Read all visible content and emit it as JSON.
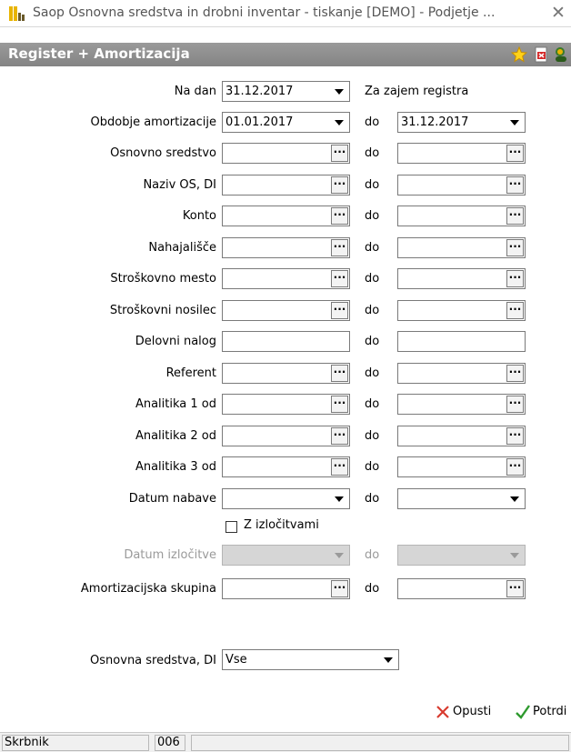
{
  "window": {
    "title": "Saop Osnovna sredstva in drobni inventar - tiskanje [DEMO] - Podjetje ...",
    "close_glyph": "✕"
  },
  "header": {
    "title": "Register + Amortizacija",
    "icons": [
      "star-icon",
      "pdf-icon",
      "user-icon"
    ]
  },
  "form": {
    "na_dan": {
      "label": "Na dan",
      "value": "31.12.2017",
      "side_label": "Za zajem registra"
    },
    "obdobje": {
      "label": "Obdobje amortizacije",
      "from": "01.01.2017",
      "to": "31.12.2017"
    },
    "do_label": "do",
    "range_rows": [
      {
        "key": "osnovno_sredstvo",
        "label": "Osnovno sredstvo",
        "type": "lookup",
        "from": "",
        "to": ""
      },
      {
        "key": "naziv_os_di",
        "label": "Naziv OS, DI",
        "type": "lookup",
        "from": "",
        "to": ""
      },
      {
        "key": "konto",
        "label": "Konto",
        "type": "lookup",
        "from": "",
        "to": ""
      },
      {
        "key": "nahajalisce",
        "label": "Nahajališče",
        "type": "lookup",
        "from": "",
        "to": ""
      },
      {
        "key": "strosek_mesto",
        "label": "Stroškovno mesto",
        "type": "lookup",
        "from": "",
        "to": ""
      },
      {
        "key": "strosek_nosilec",
        "label": "Stroškovni nosilec",
        "type": "lookup",
        "from": "",
        "to": ""
      },
      {
        "key": "delovni_nalog",
        "label": "Delovni nalog",
        "type": "text",
        "from": "",
        "to": ""
      },
      {
        "key": "referent",
        "label": "Referent",
        "type": "lookup",
        "from": "",
        "to": ""
      },
      {
        "key": "analitika1",
        "label": "Analitika 1 od",
        "type": "lookup",
        "from": "",
        "to": ""
      },
      {
        "key": "analitika2",
        "label": "Analitika 2 od",
        "type": "lookup",
        "from": "",
        "to": ""
      },
      {
        "key": "analitika3",
        "label": "Analitika 3 od",
        "type": "lookup",
        "from": "",
        "to": ""
      },
      {
        "key": "datum_nabave",
        "label": "Datum nabave",
        "type": "dropdown",
        "from": "",
        "to": ""
      }
    ],
    "z_izlocitvami": {
      "label": "Z izločitvami",
      "checked": false
    },
    "datum_izlocitve": {
      "label": "Datum izločitve",
      "from": "",
      "to": "",
      "disabled": true
    },
    "amort_skupina": {
      "label": "Amortizacijska skupina",
      "from": "",
      "to": ""
    },
    "osnovna_sredstva_di": {
      "label": "Osnovna sredstva, DI",
      "value": "Vse"
    }
  },
  "footer": {
    "cancel_label": "Opusti",
    "confirm_label": "Potrdi"
  },
  "statusbar": {
    "user": "Skrbnik",
    "code": "006"
  },
  "colors": {
    "header_bg": "#8c8c8c",
    "cancel_icon": "#d83a2e",
    "confirm_icon": "#2e9a2e"
  }
}
